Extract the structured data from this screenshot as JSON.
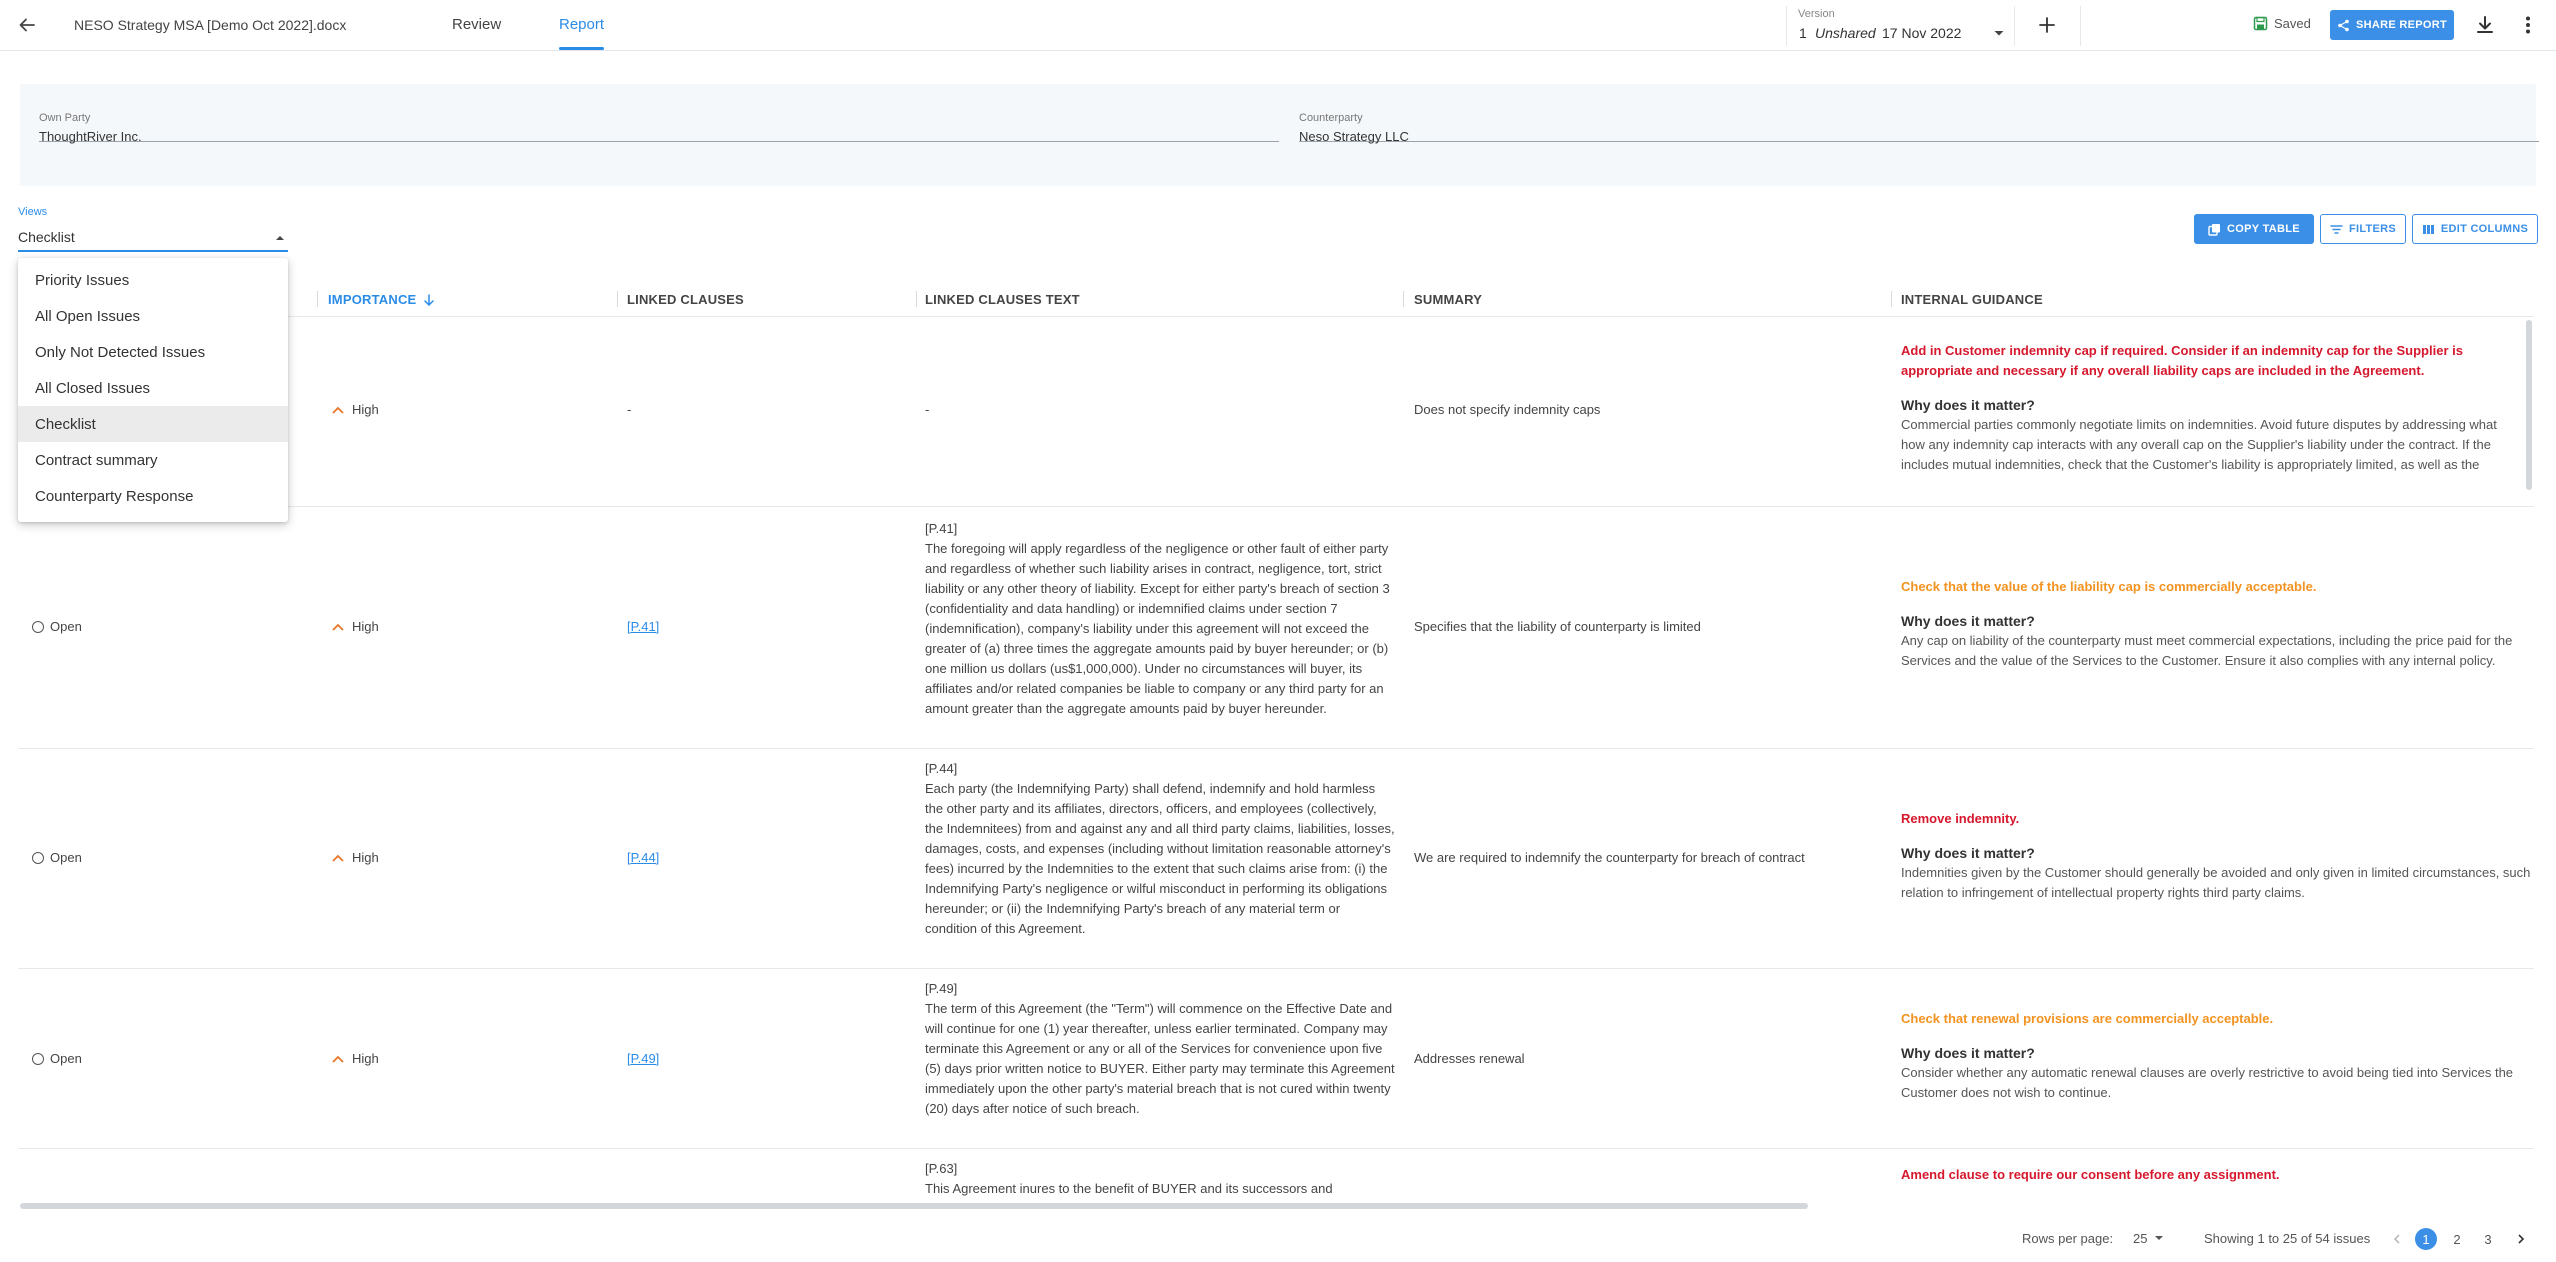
{
  "topbar": {
    "doc_title": "NESO Strategy MSA [Demo Oct 2022].docx",
    "tabs": [
      {
        "label": "Review"
      },
      {
        "label": "Report"
      }
    ],
    "version": {
      "label": "Version",
      "number": "1",
      "status": "Unshared",
      "date": "17 Nov 2022"
    },
    "saved_label": "Saved",
    "share_label": "SHARE REPORT"
  },
  "parties": {
    "own": {
      "label": "Own Party",
      "value": "ThoughtRiver Inc."
    },
    "counter": {
      "label": "Counterparty",
      "value": "Neso Strategy LLC"
    }
  },
  "views": {
    "label": "Views",
    "value": "Checklist",
    "options": [
      "Priority Issues",
      "All Open Issues",
      "Only Not Detected Issues",
      "All Closed Issues",
      "Checklist",
      "Contract summary",
      "Counterparty Response"
    ],
    "selected_index": 4
  },
  "toolbar": {
    "copy": "COPY TABLE",
    "filters": "FILTERS",
    "edit_columns": "EDIT COLUMNS"
  },
  "columns": {
    "importance": "IMPORTANCE",
    "linked_clauses": "LINKED CLAUSES",
    "linked_clauses_text": "LINKED CLAUSES TEXT",
    "summary": "SUMMARY",
    "internal_guidance": "INTERNAL GUIDANCE"
  },
  "rows": [
    {
      "status": "",
      "importance": "High",
      "clause": "-",
      "clause_ref": "",
      "clause_text": "-",
      "summary": "Does not specify indemnity caps",
      "guidance_title": "Add in Customer indemnity cap if required. Consider if an indemnity cap for the Supplier is appropriate and necessary if any overall liability caps are included in the Agreement.",
      "guidance_q": "Why does it matter?",
      "guidance_body": [
        "Commercial parties commonly negotiate limits on indemnities. Avoid future disputes by addressing what",
        "how any indemnity cap interacts with any overall cap on the Supplier's liability under the contract. If the",
        "includes mutual indemnities, check that the Customer's liability is appropriately limited, as well as the"
      ]
    },
    {
      "status": "Open",
      "importance": "High",
      "clause": "[P.41]",
      "clause_ref": "[P.41]",
      "clause_text": "The foregoing will apply regardless of the negligence or other fault of either party and regardless of whether such liability arises in contract, negligence, tort, strict liability or any other theory of liability. Except for either party's breach of section 3 (confidentiality and data handling) or indemnified claims under section 7 (indemnification), company's liability under this agreement will not exceed the greater of (a) three times the aggregate amounts paid by buyer hereunder; or (b) one million us dollars (us$1,000,000). Under no circumstances will buyer, its affiliates and/or related companies be liable to company or any third party for an amount greater than the aggregate amounts paid by buyer hereunder.",
      "summary": "Specifies that the liability of counterparty is limited",
      "guidance_title": "Check that the value of the liability cap is commercially acceptable.",
      "guidance_q": "Why does it matter?",
      "guidance_body": [
        "Any cap on liability of the counterparty must meet commercial expectations, including the price paid for the",
        "Services and the value of the Services to the Customer. Ensure it also complies with any internal policy."
      ]
    },
    {
      "status": "Open",
      "importance": "High",
      "clause": "[P.44]",
      "clause_ref": "[P.44]",
      "clause_text": "Each party (the Indemnifying Party) shall defend, indemnify and hold harmless the other party and its affiliates, directors, officers, and employees (collectively, the Indemnitees) from and against any and all third party claims, liabilities, losses, damages, costs, and expenses (including without limitation reasonable attorney's fees) incurred by the Indemnities to the extent that such claims arise from: (i) the Indemnifying Party's negligence or wilful misconduct in performing its obligations hereunder; or (ii) the Indemnifying Party's breach of any material term or condition of this Agreement.",
      "summary": "We are required to indemnify the counterparty for breach of contract",
      "guidance_title": "Remove indemnity.",
      "guidance_q": "Why does it matter?",
      "guidance_body": [
        "Indemnities given by the Customer should generally be avoided and only given in limited circumstances, such as in",
        "relation to infringement of intellectual property rights third party claims."
      ]
    },
    {
      "status": "Open",
      "importance": "High",
      "clause": "[P.49]",
      "clause_ref": "[P.49]",
      "clause_text": "The term of this Agreement (the \"Term\") will commence on the Effective Date and will continue for one (1) year thereafter, unless earlier terminated. Company may terminate this Agreement or any or all of the Services for convenience upon five (5) days prior written notice to BUYER. Either party may terminate this Agreement immediately upon the other party's material breach that is not cured within twenty (20) days after notice of such breach.",
      "summary": "Addresses renewal",
      "guidance_title": "Check that renewal provisions are commercially acceptable.",
      "guidance_q": "Why does it matter?",
      "guidance_body": [
        "Consider whether any automatic renewal clauses are overly restrictive to avoid being tied into Services the",
        "Customer does not wish to continue."
      ]
    },
    {
      "clause_ref": "[P.63]",
      "clause_text_partial": "This Agreement inures to the benefit of BUYER and its successors and",
      "guidance_title": "Amend clause to require our consent before any assignment."
    }
  ],
  "footer": {
    "rows_per_page_label": "Rows per page:",
    "rows_per_page": "25",
    "showing": "Showing 1 to 25 of 54 issues",
    "pages": [
      "1",
      "2",
      "3"
    ]
  },
  "colors": {
    "accent": "#3b8fe6",
    "red": "#d6182d",
    "orange": "#f39321",
    "high": "#e8742a"
  }
}
